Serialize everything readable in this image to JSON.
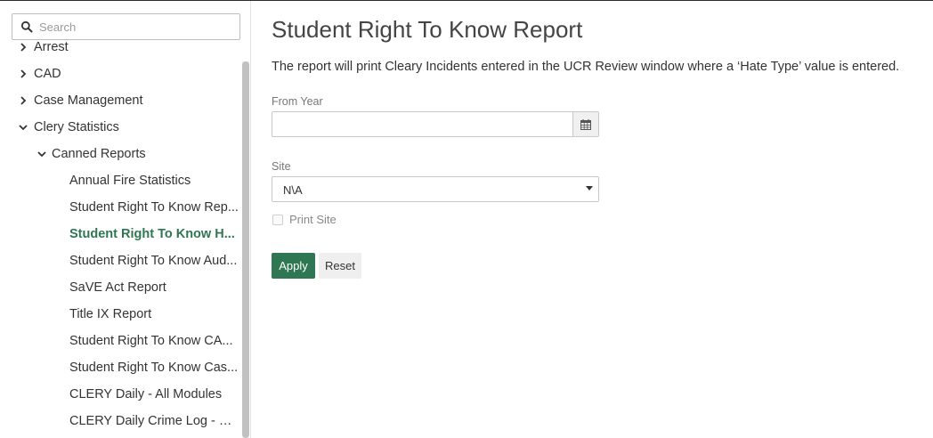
{
  "search": {
    "placeholder": "Search"
  },
  "sidebar": {
    "items": [
      {
        "label": "Arrest",
        "expanded": false,
        "active": false
      },
      {
        "label": "CAD",
        "expanded": false,
        "active": false
      },
      {
        "label": "Case Management",
        "expanded": false,
        "active": false
      },
      {
        "label": "Clery Statistics",
        "expanded": true,
        "active": false
      },
      {
        "label": "Canned Reports",
        "expanded": true,
        "active": false
      },
      {
        "label": "Annual Fire Statistics",
        "active": false
      },
      {
        "label": "Student Right To Know Rep...",
        "active": false
      },
      {
        "label": "Student Right To Know H...",
        "active": true
      },
      {
        "label": "Student Right To Know Aud...",
        "active": false
      },
      {
        "label": "SaVE Act Report",
        "active": false
      },
      {
        "label": "Title IX Report",
        "active": false
      },
      {
        "label": "Student Right To Know CA...",
        "active": false
      },
      {
        "label": "Student Right To Know Cas...",
        "active": false
      },
      {
        "label": "CLERY Daily - All Modules",
        "active": false
      },
      {
        "label": "CLERY Daily Crime Log - Ca...",
        "active": false
      }
    ]
  },
  "main": {
    "title": "Student Right To Know Report",
    "description": "The report will print Cleary Incidents entered in the UCR Review window where a ‘Hate Type’ value is entered.",
    "from_year_label": "From Year",
    "from_year_value": "",
    "site_label": "Site",
    "site_value": "N\\A",
    "print_site_label": "Print Site",
    "print_site_checked": false,
    "apply_label": "Apply",
    "reset_label": "Reset"
  },
  "colors": {
    "accent": "#2e7752",
    "active_text": "#2e7752",
    "scroll_thumb": "#c1c1c1"
  },
  "icons": {
    "search": "search-icon",
    "calendar": "calendar-icon",
    "chevron_right": "chevron-right-icon",
    "chevron_down": "chevron-down-icon",
    "select_caret": "caret-down-icon"
  }
}
